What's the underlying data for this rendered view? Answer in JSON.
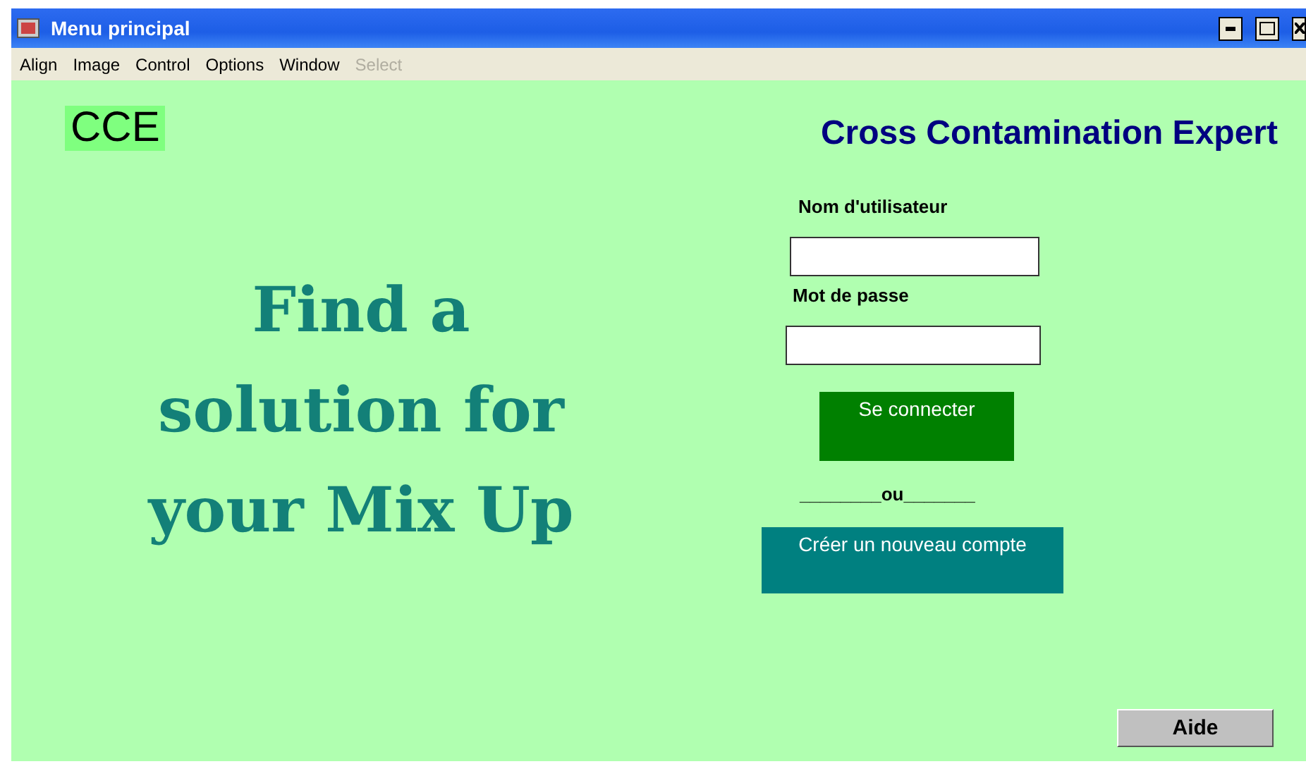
{
  "window": {
    "title": "Menu principal"
  },
  "menu": [
    {
      "label": "Align",
      "disabled": false
    },
    {
      "label": "Image",
      "disabled": false
    },
    {
      "label": "Control",
      "disabled": false
    },
    {
      "label": "Options",
      "disabled": false
    },
    {
      "label": "Window",
      "disabled": false
    },
    {
      "label": "Select",
      "disabled": true
    }
  ],
  "logo": "CCE",
  "app_title": "Cross Contamination Expert",
  "slogan": "Find a solution for your Mix Up",
  "login": {
    "username_label": "Nom d'utilisateur",
    "password_label": "Mot de passe",
    "submit": "Se connecter",
    "separator": "________ou_______",
    "create_account": "Créer un nouveau compte"
  },
  "help_button": "Aide"
}
